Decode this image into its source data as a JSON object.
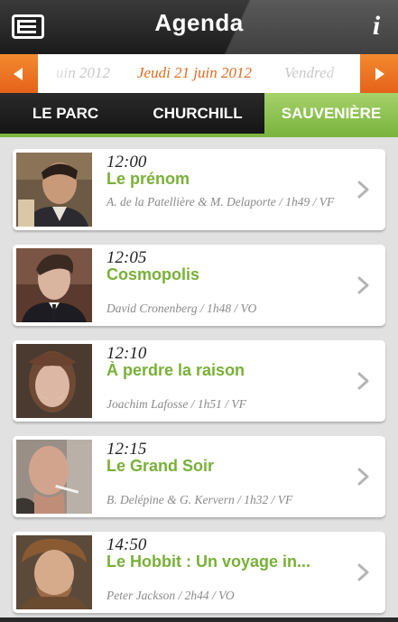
{
  "header": {
    "title": "Agenda",
    "agenda_icon": "agenda-list-icon",
    "info_icon": "info-icon",
    "info_label": "i"
  },
  "date_nav": {
    "previous": "uin 2012",
    "current": "Jeudi 21 juin 2012",
    "next": "Vendred",
    "left_arrow_icon": "arrow-left-icon",
    "right_arrow_icon": "arrow-right-icon"
  },
  "tabs": [
    {
      "label": "LE PARC",
      "active": false
    },
    {
      "label": "CHURCHILL",
      "active": false
    },
    {
      "label": "SAUVENIÈRE",
      "active": true
    }
  ],
  "screenings": [
    {
      "time": "12:00",
      "title": "Le prénom",
      "credits": "A. de la Patellière & M. Delaporte / 1h49 / VF"
    },
    {
      "time": "12:05",
      "title": "Cosmopolis",
      "credits": "David Cronenberg / 1h48 / VO"
    },
    {
      "time": "12:10",
      "title": "À perdre la raison",
      "credits": "Joachim Lafosse / 1h51 / VF"
    },
    {
      "time": "12:15",
      "title": "Le Grand Soir",
      "credits": "B. Delépine & G. Kervern / 1h32 / VF"
    },
    {
      "time": "14:50",
      "title": "Le Hobbit : Un voyage in...",
      "credits": "Peter Jackson / 2h44 / VO"
    }
  ],
  "colors": {
    "accent_green": "#78b037",
    "accent_orange": "#e5621a",
    "header_dark": "#1b1b1b"
  }
}
